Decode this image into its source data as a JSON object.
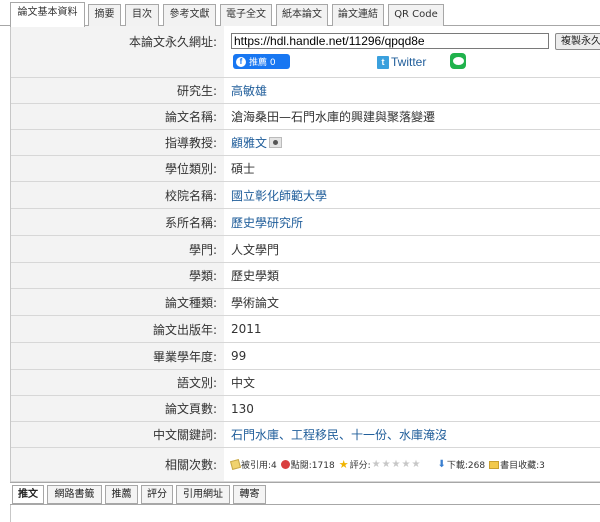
{
  "top_tabs": [
    {
      "label": "論文基本資料",
      "active": true
    },
    {
      "label": "摘要",
      "active": false
    },
    {
      "label": "目次",
      "active": false
    },
    {
      "label": "參考文獻",
      "active": false
    },
    {
      "label": "電子全文",
      "active": false
    },
    {
      "label": "紙本論文",
      "active": false
    },
    {
      "label": "論文連結",
      "active": false
    },
    {
      "label": "QR Code",
      "active": false
    }
  ],
  "url_row": {
    "label": "本論文永久網址:",
    "url": "https://hdl.handle.net/11296/qpqd8e",
    "copy_button": "複製永久網址",
    "fb_button": "推薦 0",
    "twitter": "Twitter"
  },
  "fields": [
    {
      "label": "研究生:",
      "value": "高敏雄",
      "link": true
    },
    {
      "label": "論文名稱:",
      "value": "滄海桑田—石門水庫的興建與聚落變遷",
      "link": false
    },
    {
      "label": "指導教授:",
      "value": "顧雅文",
      "link": true
    },
    {
      "label": "學位類別:",
      "value": "碩士",
      "link": false
    },
    {
      "label": "校院名稱:",
      "value": "國立彰化師範大學",
      "link": true
    },
    {
      "label": "系所名稱:",
      "value": "歷史學研究所",
      "link": true
    },
    {
      "label": "學門:",
      "value": "人文學門",
      "link": false
    },
    {
      "label": "學類:",
      "value": "歷史學類",
      "link": false
    },
    {
      "label": "論文種類:",
      "value": "學術論文",
      "link": false
    },
    {
      "label": "論文出版年:",
      "value": "2011",
      "link": false
    },
    {
      "label": "畢業學年度:",
      "value": "99",
      "link": false
    },
    {
      "label": "語文別:",
      "value": "中文",
      "link": false
    },
    {
      "label": "論文頁數:",
      "value": "130",
      "link": false
    },
    {
      "label": "中文關鍵詞:",
      "value": "石門水庫、工程移民、十一份、水庫淹沒",
      "link": true
    }
  ],
  "stats": {
    "label": "相關次數:",
    "cited": "被引用:4",
    "clicks": "點閱:1718",
    "rating": "評分:",
    "downloads": "下載:268",
    "bookmarks": "書目收藏:3"
  },
  "bottom_tabs": [
    {
      "label": "推文",
      "active": true
    },
    {
      "label": "網路書籤",
      "active": false
    },
    {
      "label": "推薦",
      "active": false
    },
    {
      "label": "評分",
      "active": false
    },
    {
      "label": "引用網址",
      "active": false
    },
    {
      "label": "轉寄",
      "active": false
    }
  ]
}
